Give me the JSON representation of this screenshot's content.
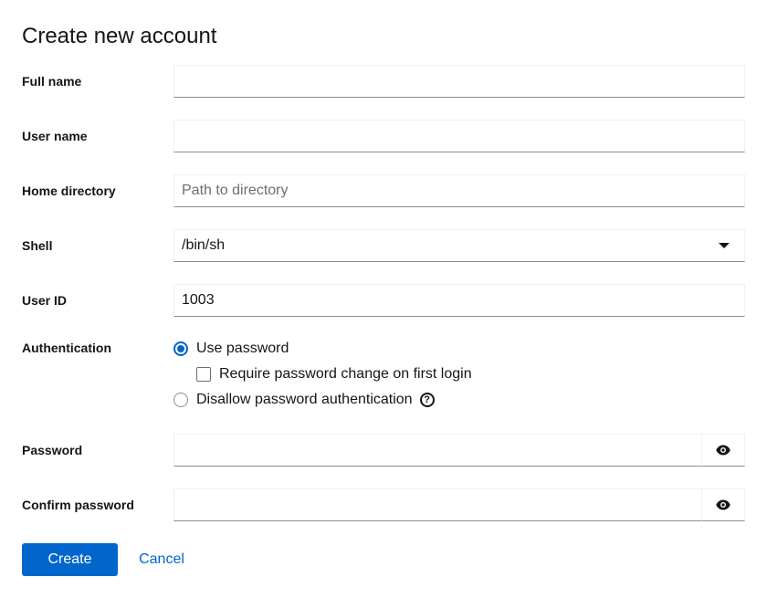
{
  "dialog": {
    "title": "Create new account"
  },
  "fields": {
    "full_name": {
      "label": "Full name",
      "value": "",
      "placeholder": ""
    },
    "user_name": {
      "label": "User name",
      "value": "",
      "placeholder": ""
    },
    "home_directory": {
      "label": "Home directory",
      "value": "",
      "placeholder": "Path to directory"
    },
    "shell": {
      "label": "Shell",
      "value": "/bin/sh"
    },
    "user_id": {
      "label": "User ID",
      "value": "1003"
    },
    "password": {
      "label": "Password",
      "value": ""
    },
    "confirm_password": {
      "label": "Confirm password",
      "value": ""
    }
  },
  "authentication": {
    "label": "Authentication",
    "use_password": {
      "label": "Use password",
      "selected": true
    },
    "require_change": {
      "label": "Require password change on first login",
      "checked": false
    },
    "disallow": {
      "label": "Disallow password authentication",
      "selected": false
    },
    "help_glyph": "?"
  },
  "icons": {
    "eye": "eye-icon",
    "help": "question-circle-icon",
    "dropdown": "caret-down-icon"
  },
  "colors": {
    "primary": "#0066cc",
    "text": "#151515",
    "border": "#8a8d90"
  },
  "actions": {
    "create_label": "Create",
    "cancel_label": "Cancel"
  }
}
